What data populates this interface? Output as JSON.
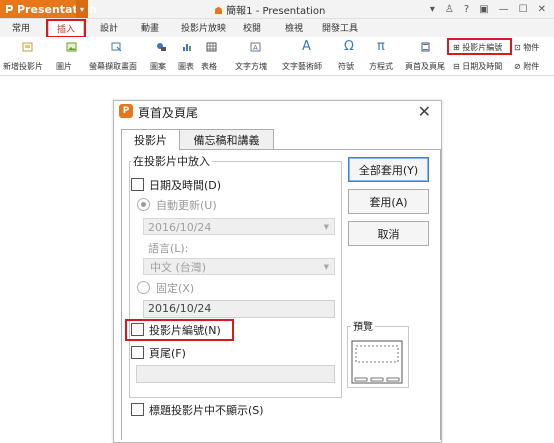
{
  "app": {
    "name": "Presentation",
    "window_title": "簡報1 - Presentation"
  },
  "tabs": [
    "常用",
    "插入",
    "設計",
    "動畫",
    "投影片放映",
    "校閱",
    "檢視",
    "開發工具"
  ],
  "active_tab": "插入",
  "ribbon": {
    "items": [
      "新增投影片",
      "圖片",
      "螢幕擷取畫面",
      "圖案",
      "圖表",
      "表格",
      "文字方塊",
      "文字藝術師",
      "符號",
      "方程式",
      "頁首及頁尾",
      "投影片編號",
      "物件",
      "日期及時間",
      "附件"
    ]
  },
  "dialog": {
    "title": "頁首及頁尾",
    "tabs": [
      "投影片",
      "備忘稿和講義"
    ],
    "group_label": "在投影片中放入",
    "date_time_label": "日期及時間(D)",
    "auto_update_label": "自動更新(U)",
    "auto_date_value": "2016/10/24",
    "language_label": "語言(L):",
    "language_value": "中文 (台灣)",
    "fixed_label": "固定(X)",
    "fixed_date_value": "2016/10/24",
    "slide_number_label": "投影片編號(N)",
    "footer_label": "頁尾(F)",
    "footer_value": "",
    "hide_on_title_label": "標題投影片中不顯示(S)",
    "buttons": {
      "apply_all": "全部套用(Y)",
      "apply": "套用(A)",
      "cancel": "取消"
    },
    "preview_label": "預覽"
  },
  "colors": {
    "accent": "#e8761a",
    "highlight": "#d9191f",
    "focus": "#3c7fd6"
  }
}
